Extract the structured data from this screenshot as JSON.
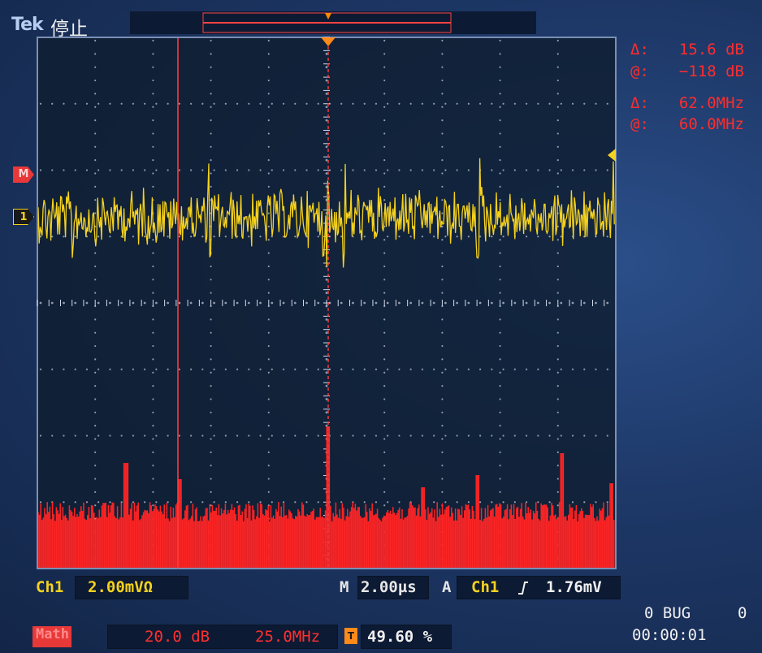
{
  "header": {
    "brand": "Tek",
    "acquisition_state": "停止"
  },
  "cursor_readouts": {
    "amplitude_delta_label": "Δ:",
    "amplitude_delta_value": "15.6 dB",
    "amplitude_at_label": "@:",
    "amplitude_at_value": "−118 dB",
    "frequency_delta_label": "Δ:",
    "frequency_delta_value": "62.0MHz",
    "frequency_at_label": "@:",
    "frequency_at_value": "60.0MHz"
  },
  "markers": {
    "math": "M",
    "ch1": "1"
  },
  "channel": {
    "label": "Ch1",
    "scale": "2.00mVΩ"
  },
  "timebase": {
    "label": "M",
    "value": "2.00µs"
  },
  "trigger": {
    "label": "A",
    "source": "Ch1",
    "slope_icon": "rising-edge-icon",
    "level": "1.76mV"
  },
  "math": {
    "label": "Math",
    "scale": "20.0 dB",
    "frequency_span": "25.0MHz",
    "position_marker": "T",
    "position": "49.60 %"
  },
  "status": {
    "line1_count": "0 BUG",
    "line1_right": "0",
    "elapsed": "00:00:01"
  },
  "colors": {
    "ch1_trace": "#f6d21d",
    "math_trace": "#ff2424",
    "cursor": "#ff3a3a",
    "background": "#1d3766"
  }
}
